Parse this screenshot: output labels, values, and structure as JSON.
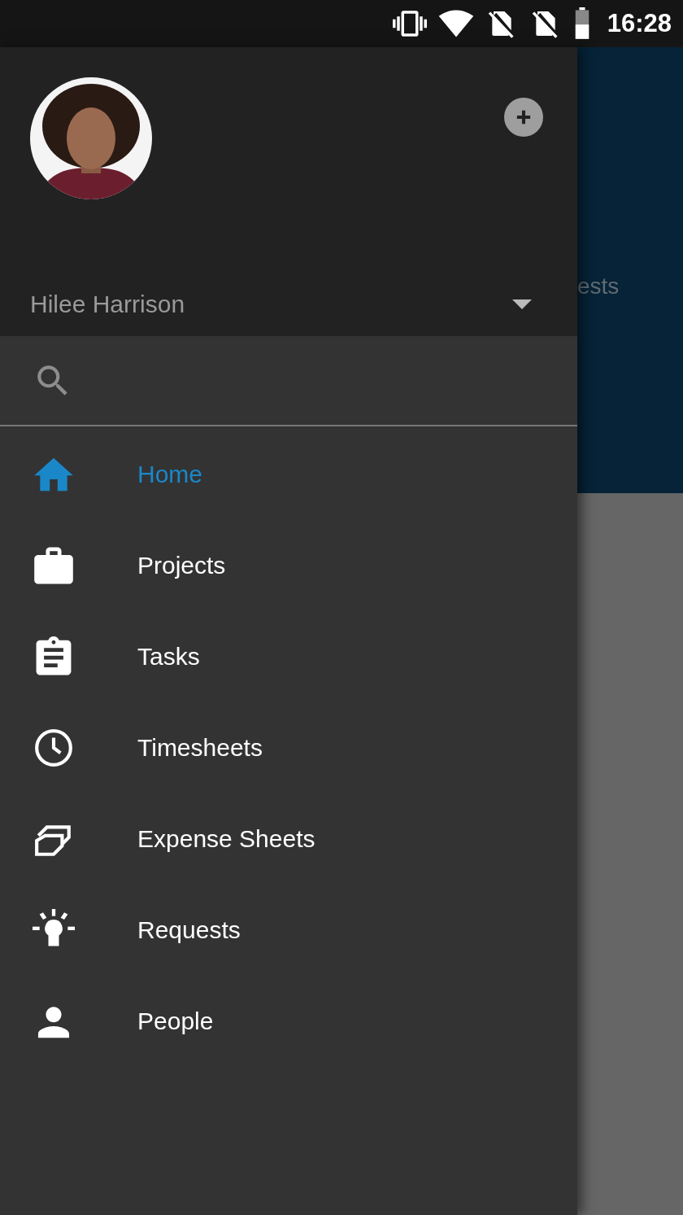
{
  "status_bar": {
    "time": "16:28"
  },
  "drawer": {
    "account": {
      "name": "Hilee Harrison"
    },
    "items": [
      {
        "label": "Home",
        "kind": "home",
        "selected": true
      },
      {
        "label": "Projects",
        "kind": "briefcase",
        "selected": false
      },
      {
        "label": "Tasks",
        "kind": "clipboard",
        "selected": false
      },
      {
        "label": "Timesheets",
        "kind": "clock",
        "selected": false
      },
      {
        "label": "Expense Sheets",
        "kind": "cards",
        "selected": false
      },
      {
        "label": "Requests",
        "kind": "bulb",
        "selected": false
      },
      {
        "label": "People",
        "kind": "person",
        "selected": false
      }
    ]
  },
  "background": {
    "title": "ests"
  }
}
